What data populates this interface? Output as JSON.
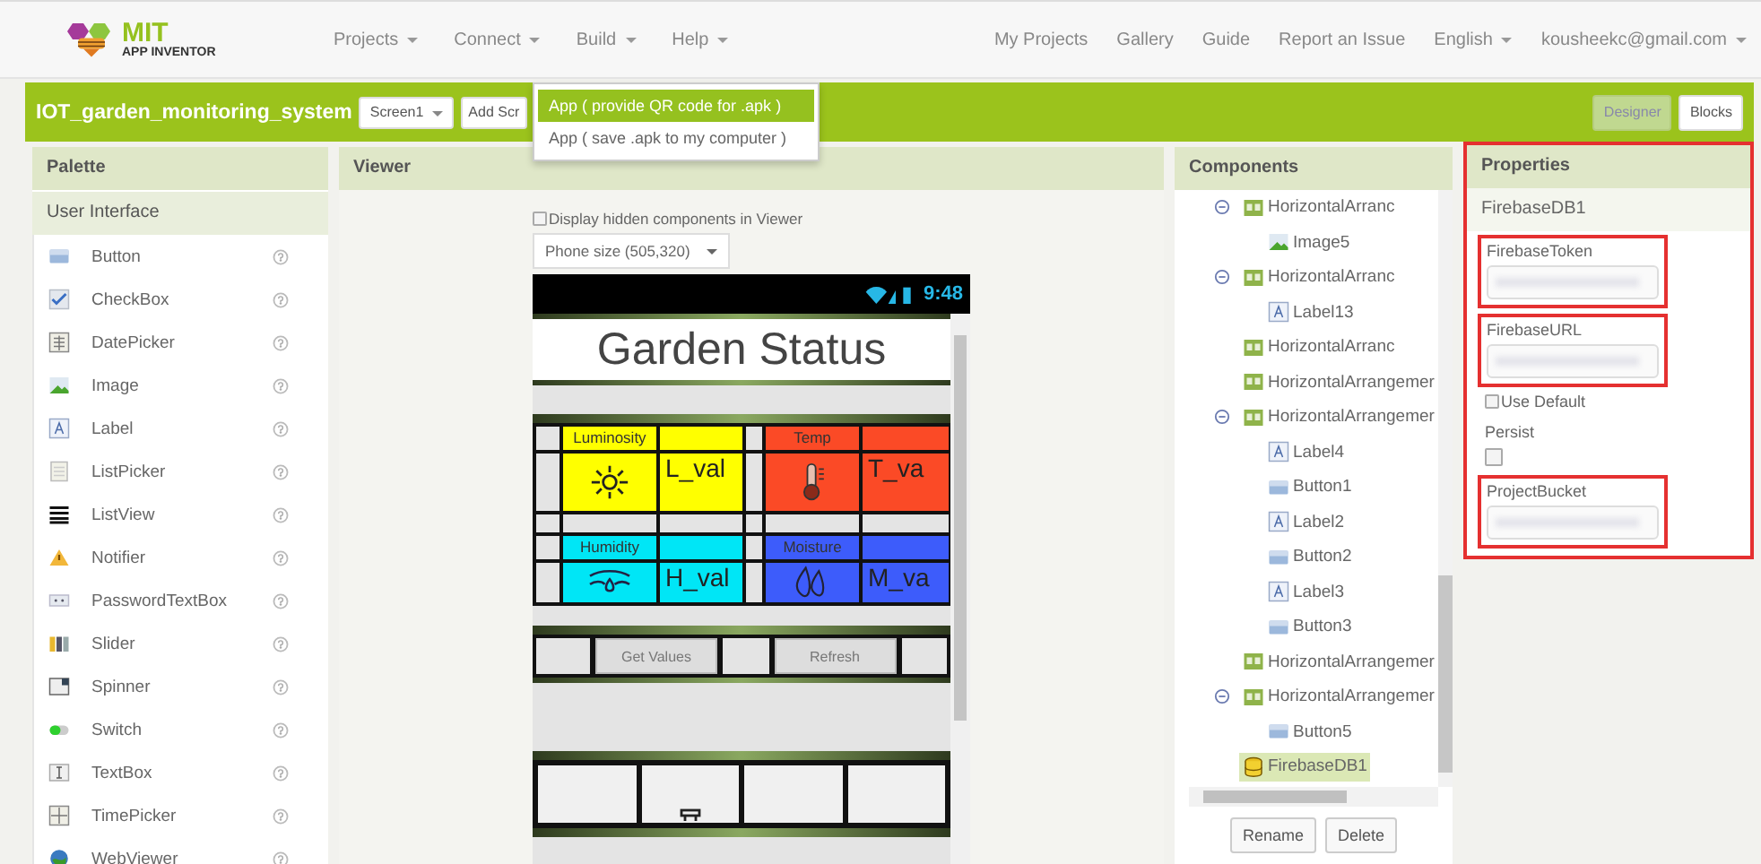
{
  "topbar": {
    "logo": {
      "title": "MIT",
      "subtitle": "APP INVENTOR"
    },
    "menus": [
      {
        "label": "Projects",
        "dropdown": true
      },
      {
        "label": "Connect",
        "dropdown": true
      },
      {
        "label": "Build",
        "dropdown": true
      },
      {
        "label": "Help",
        "dropdown": true
      }
    ],
    "links": [
      {
        "label": "My Projects",
        "dropdown": false
      },
      {
        "label": "Gallery",
        "dropdown": false
      },
      {
        "label": "Guide",
        "dropdown": false
      },
      {
        "label": "Report an Issue",
        "dropdown": false
      },
      {
        "label": "English",
        "dropdown": true
      },
      {
        "label": "kousheekc@gmail.com",
        "dropdown": true
      }
    ]
  },
  "build_menu": {
    "items": [
      {
        "label": "App ( provide QR code for .apk )",
        "selected": true
      },
      {
        "label": "App ( save .apk to my computer )",
        "selected": false
      }
    ]
  },
  "toolbar": {
    "project": "IOT_garden_monitoring_system",
    "screen": "Screen1",
    "add_screen": "Add Scr",
    "views": [
      {
        "label": "Designer",
        "selected": true
      },
      {
        "label": "Blocks",
        "selected": false
      }
    ]
  },
  "palette": {
    "title": "Palette",
    "section": "User Interface",
    "items": [
      {
        "label": "Button",
        "kind": "button"
      },
      {
        "label": "CheckBox",
        "kind": "checkbox"
      },
      {
        "label": "DatePicker",
        "kind": "datepicker"
      },
      {
        "label": "Image",
        "kind": "image"
      },
      {
        "label": "Label",
        "kind": "label"
      },
      {
        "label": "ListPicker",
        "kind": "listpicker"
      },
      {
        "label": "ListView",
        "kind": "listview"
      },
      {
        "label": "Notifier",
        "kind": "notifier"
      },
      {
        "label": "PasswordTextBox",
        "kind": "password"
      },
      {
        "label": "Slider",
        "kind": "slider"
      },
      {
        "label": "Spinner",
        "kind": "spinner"
      },
      {
        "label": "Switch",
        "kind": "switch"
      },
      {
        "label": "TextBox",
        "kind": "textbox"
      },
      {
        "label": "TimePicker",
        "kind": "timepicker"
      },
      {
        "label": "WebViewer",
        "kind": "webviewer"
      }
    ]
  },
  "viewer": {
    "title": "Viewer",
    "hidden_checkbox": {
      "label": "Display hidden components in Viewer",
      "checked": false
    },
    "size": "Phone size (505,320)",
    "phone": {
      "time": "9:48",
      "title": "Garden Status",
      "sensors": [
        {
          "label": "Luminosity",
          "value": "L_val",
          "color": "#ffff00",
          "kind": "sun"
        },
        {
          "label": "Temp",
          "value": "T_va",
          "color": "#fb4a26",
          "kind": "thermometer"
        },
        {
          "label": "Humidity",
          "value": "H_val",
          "color": "#00e6f6",
          "kind": "humidity"
        },
        {
          "label": "Moisture",
          "value": "M_va",
          "color": "#3d5cfb",
          "kind": "drops"
        }
      ],
      "buttons": [
        "Get Values",
        "Refresh"
      ]
    }
  },
  "components": {
    "title": "Components",
    "tree": [
      {
        "label": "HorizontalArranc",
        "kind": "arrangement",
        "selected": false,
        "expanded": true,
        "children": [
          {
            "label": "Image5",
            "kind": "image",
            "selected": false
          }
        ]
      },
      {
        "label": "HorizontalArranc",
        "kind": "arrangement",
        "selected": false,
        "expanded": true,
        "children": [
          {
            "label": "Label13",
            "kind": "label",
            "selected": false
          }
        ]
      },
      {
        "label": "HorizontalArranc",
        "kind": "arrangement",
        "selected": false
      },
      {
        "label": "HorizontalArrangemer",
        "kind": "arrangement",
        "selected": false
      },
      {
        "label": "HorizontalArrangemer",
        "kind": "arrangement",
        "selected": false,
        "expanded": true,
        "children": [
          {
            "label": "Label4",
            "kind": "label",
            "selected": false
          },
          {
            "label": "Button1",
            "kind": "button",
            "selected": false
          },
          {
            "label": "Label2",
            "kind": "label",
            "selected": false
          },
          {
            "label": "Button2",
            "kind": "button",
            "selected": false
          },
          {
            "label": "Label3",
            "kind": "label",
            "selected": false
          },
          {
            "label": "Button3",
            "kind": "button",
            "selected": false
          }
        ]
      },
      {
        "label": "HorizontalArrangemer",
        "kind": "arrangement",
        "selected": false
      },
      {
        "label": "HorizontalArrangemer",
        "kind": "arrangement",
        "selected": false,
        "expanded": true,
        "children": [
          {
            "label": "Button5",
            "kind": "button",
            "selected": false
          }
        ]
      },
      {
        "label": "FirebaseDB1",
        "kind": "firebase",
        "selected": true
      }
    ],
    "buttons": [
      "Rename",
      "Delete"
    ]
  },
  "properties": {
    "title": "Properties",
    "highlighted": true,
    "component": "FirebaseDB1",
    "items": [
      {
        "kind": "field",
        "label": "FirebaseToken",
        "highlighted": true
      },
      {
        "kind": "field",
        "label": "FirebaseURL",
        "highlighted": true
      },
      {
        "kind": "inline_checkbox",
        "label": "Use Default",
        "checked": false
      },
      {
        "kind": "checkbox",
        "label": "Persist",
        "checked": false
      },
      {
        "kind": "field",
        "label": "ProjectBucket",
        "highlighted": true
      }
    ]
  }
}
